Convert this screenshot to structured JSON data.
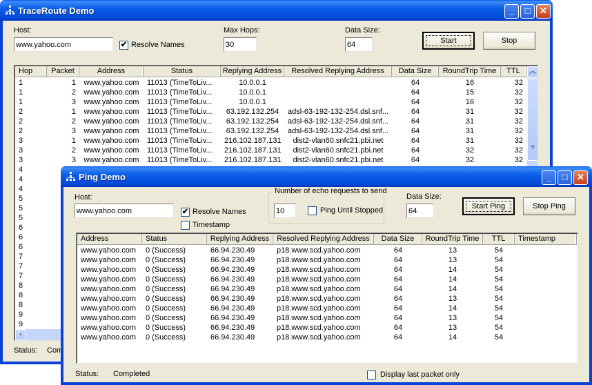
{
  "traceroute": {
    "title": "TraceRoute Demo",
    "host_label": "Host:",
    "host_value": "www.yahoo.com",
    "resolve_names_label": "Resolve Names",
    "resolve_names_checked": true,
    "max_hops_label": "Max Hops:",
    "max_hops_value": "30",
    "data_size_label": "Data Size:",
    "data_size_value": "64",
    "start_label": "Start",
    "stop_label": "Stop",
    "status_label": "Status:",
    "status_value": "Com",
    "columns": [
      "Hop",
      "Packet",
      "Address",
      "Status",
      "Replying Address",
      "Resolved Replying Address",
      "Data Size",
      "RoundTrip Time",
      "TTL"
    ],
    "rows": [
      [
        "1",
        "1",
        "www.yahoo.com",
        "11013 (TimeToLiv...",
        "10.0.0.1",
        "",
        "64",
        "16",
        "32"
      ],
      [
        "1",
        "2",
        "www.yahoo.com",
        "11013 (TimeToLiv...",
        "10.0.0.1",
        "",
        "64",
        "15",
        "32"
      ],
      [
        "1",
        "3",
        "www.yahoo.com",
        "11013 (TimeToLiv...",
        "10.0.0.1",
        "",
        "64",
        "16",
        "32"
      ],
      [
        "2",
        "1",
        "www.yahoo.com",
        "11013 (TimeToLiv...",
        "63.192.132.254",
        "adsl-63-192-132-254.dsl.snf...",
        "64",
        "31",
        "32"
      ],
      [
        "2",
        "2",
        "www.yahoo.com",
        "11013 (TimeToLiv...",
        "63.192.132.254",
        "adsl-63-192-132-254.dsl.snf...",
        "64",
        "31",
        "32"
      ],
      [
        "2",
        "3",
        "www.yahoo.com",
        "11013 (TimeToLiv...",
        "63.192.132.254",
        "adsl-63-192-132-254.dsl.snf...",
        "64",
        "31",
        "32"
      ],
      [
        "3",
        "1",
        "www.yahoo.com",
        "11013 (TimeToLiv...",
        "216.102.187.131",
        "dist2-vlan60.snfc21.pbi.net",
        "64",
        "31",
        "32"
      ],
      [
        "3",
        "2",
        "www.yahoo.com",
        "11013 (TimeToLiv...",
        "216.102.187.131",
        "dist2-vlan60.snfc21.pbi.net",
        "64",
        "32",
        "32"
      ],
      [
        "3",
        "3",
        "www.yahoo.com",
        "11013 (TimeToLiv...",
        "216.102.187.131",
        "dist2-vlan60.snfc21.pbi.net",
        "64",
        "32",
        "32"
      ],
      [
        "4"
      ],
      [
        "4"
      ],
      [
        "4"
      ],
      [
        "5"
      ],
      [
        "5"
      ],
      [
        "5"
      ],
      [
        "6"
      ],
      [
        "6"
      ],
      [
        "6"
      ],
      [
        "7"
      ],
      [
        "7"
      ],
      [
        "7"
      ],
      [
        "8"
      ],
      [
        "8"
      ],
      [
        "8"
      ],
      [
        "9"
      ],
      [
        "9"
      ]
    ]
  },
  "ping": {
    "title": "Ping Demo",
    "host_label": "Host:",
    "host_value": "www.yahoo.com",
    "resolve_names_label": "Resolve Names",
    "resolve_names_checked": true,
    "timestamp_label": "Timestamp",
    "timestamp_checked": false,
    "echo_group_label": "Number of echo requests to send",
    "echo_count_value": "10",
    "ping_until_stopped_label": "Ping Until Stopped",
    "ping_until_stopped_checked": false,
    "data_size_label": "Data Size:",
    "data_size_value": "64",
    "start_label": "Start Ping",
    "stop_label": "Stop Ping",
    "status_label": "Status:",
    "status_value": "Completed",
    "display_last_label": "Display last packet only",
    "display_last_checked": false,
    "columns": [
      "Address",
      "Status",
      "Replying Address",
      "Resolved Replying Address",
      "Data Size",
      "RoundTrip Time",
      "TTL",
      "Timestamp"
    ],
    "rows": [
      [
        "www.yahoo.com",
        "0 (Success)",
        "66.94.230.49",
        "p18.www.scd.yahoo.com",
        "64",
        "13",
        "54",
        ""
      ],
      [
        "www.yahoo.com",
        "0 (Success)",
        "66.94.230.49",
        "p18.www.scd.yahoo.com",
        "64",
        "13",
        "54",
        ""
      ],
      [
        "www.yahoo.com",
        "0 (Success)",
        "66.94.230.49",
        "p18.www.scd.yahoo.com",
        "64",
        "14",
        "54",
        ""
      ],
      [
        "www.yahoo.com",
        "0 (Success)",
        "66.94.230.49",
        "p18.www.scd.yahoo.com",
        "64",
        "14",
        "54",
        ""
      ],
      [
        "www.yahoo.com",
        "0 (Success)",
        "66.94.230.49",
        "p18.www.scd.yahoo.com",
        "64",
        "14",
        "54",
        ""
      ],
      [
        "www.yahoo.com",
        "0 (Success)",
        "66.94.230.49",
        "p18.www.scd.yahoo.com",
        "64",
        "13",
        "54",
        ""
      ],
      [
        "www.yahoo.com",
        "0 (Success)",
        "66.94.230.49",
        "p18.www.scd.yahoo.com",
        "64",
        "14",
        "54",
        ""
      ],
      [
        "www.yahoo.com",
        "0 (Success)",
        "66.94.230.49",
        "p18.www.scd.yahoo.com",
        "64",
        "13",
        "54",
        ""
      ],
      [
        "www.yahoo.com",
        "0 (Success)",
        "66.94.230.49",
        "p18.www.scd.yahoo.com",
        "64",
        "13",
        "54",
        ""
      ],
      [
        "www.yahoo.com",
        "0 (Success)",
        "66.94.230.49",
        "p18.www.scd.yahoo.com",
        "64",
        "14",
        "54",
        ""
      ]
    ]
  },
  "icons": {
    "minimize": "_",
    "maximize": "□",
    "close": "✕",
    "check": "✔",
    "scroll_up": "︿",
    "scroll_left": "‹",
    "grip": "≡"
  }
}
